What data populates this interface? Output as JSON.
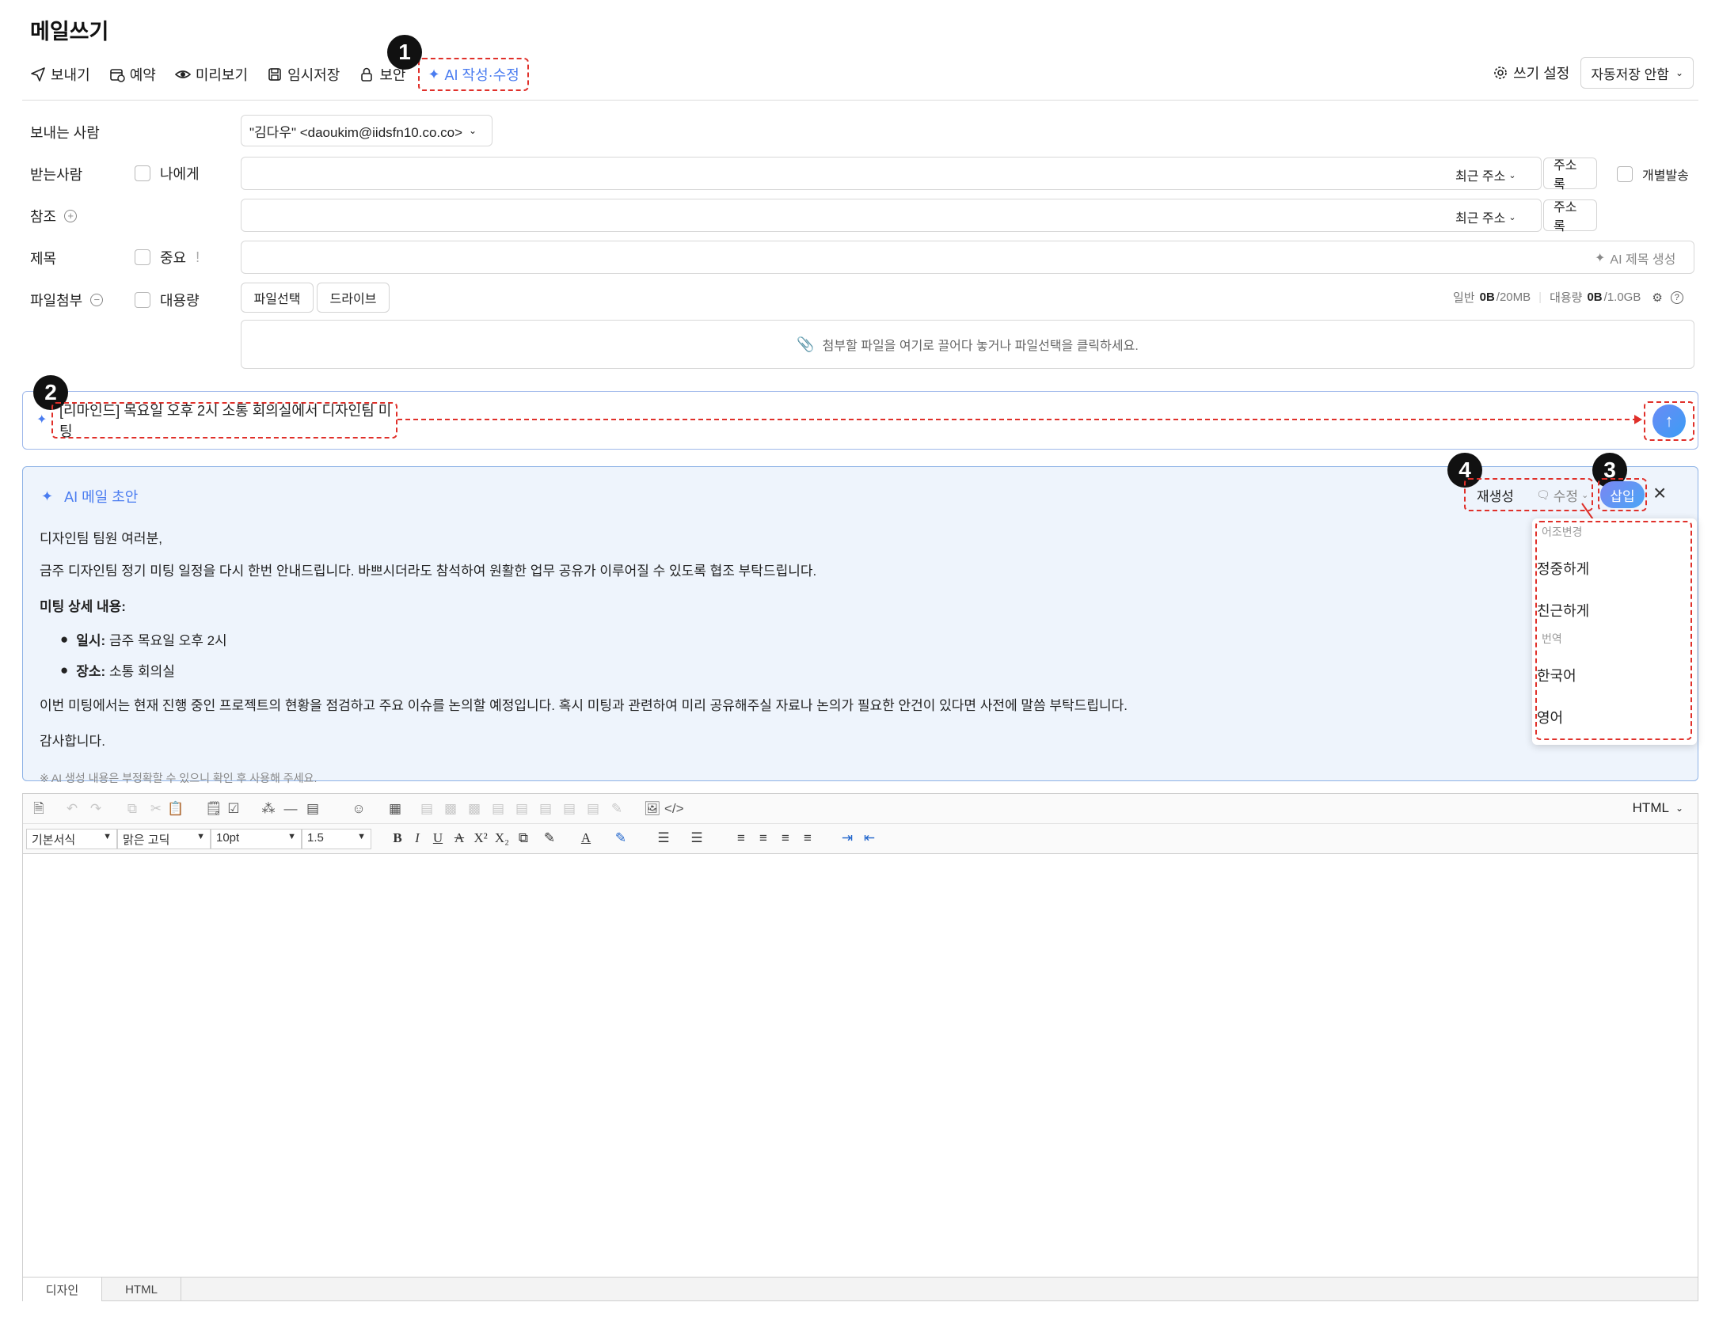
{
  "page_title": "메일쓰기",
  "toolbar": {
    "send": "보내기",
    "reserve": "예약",
    "preview": "미리보기",
    "draft_save": "임시저장",
    "security": "보안",
    "ai_compose": "AI 작성·수정",
    "write_settings": "쓰기 설정",
    "autosave": "자동저장 안함"
  },
  "markers": [
    "1",
    "2",
    "3",
    "4"
  ],
  "form": {
    "sender_label": "보내는 사람",
    "sender_value": "\"김다우\" <daoukim@iidsfn10.co.co>",
    "to_label": "받는사람",
    "to_self": "나에게",
    "recent_address": "최근 주소",
    "address_book": "주소록",
    "individual_send": "개별발송",
    "cc_label": "참조",
    "subject_label": "제목",
    "important": "중요",
    "important_mark": "!",
    "ai_subject": "AI 제목 생성",
    "attach_label": "파일첨부",
    "large_file": "대용량",
    "file_select": "파일선택",
    "drive": "드라이브",
    "quota_normal_label": "일반",
    "quota_normal_used": "0B",
    "quota_normal_total": "/20MB",
    "quota_large_label": "대용량",
    "quota_large_used": "0B",
    "quota_large_total": "/1.0GB",
    "drop_hint": "첨부할 파일을 여기로 끌어다 놓거나 파일선택을 클릭하세요."
  },
  "prompt": {
    "text": "[리마인드] 목요일 오후 2시 소통 회의실에서 디자인팀 미팅"
  },
  "ai_draft": {
    "header": "AI 메일 초안",
    "regenerate": "재생성",
    "edit": "수정",
    "insert": "삽입",
    "greeting": "디자인팀 팀원 여러분,",
    "intro": "금주 디자인팀 정기 미팅 일정을 다시 한번 안내드립니다. 바쁘시더라도 참석하여 원활한 업무 공유가 이루어질 수 있도록 협조 부탁드립니다.",
    "detail_heading": "미팅 상세 내용:",
    "bullets": [
      {
        "key": "일시:",
        "value": " 금주 목요일 오후 2시"
      },
      {
        "key": "장소:",
        "value": " 소통 회의실"
      }
    ],
    "body": "이번 미팅에서는 현재 진행 중인 프로젝트의 현황을 점검하고 주요 이슈를 논의할 예정입니다. 혹시 미팅과 관련하여 미리 공유해주실 자료나 논의가 필요한 안건이 있다면 사전에 말씀 부탁드립니다.",
    "closing": "감사합니다.",
    "disclaimer": "※ AI 생성 내용은 부정확할 수 있으니 확인 후 사용해 주세요."
  },
  "edit_menu": {
    "tone_header": "어조변경",
    "tone_items": [
      "정중하게",
      "친근하게"
    ],
    "translate_header": "번역",
    "translate_items": [
      "한국어",
      "영어"
    ]
  },
  "editor": {
    "mode": "HTML",
    "style_select": "기본서식",
    "font_select": "맑은 고딕",
    "size_select": "10pt",
    "line_height_select": "1.5",
    "tabs": [
      "디자인",
      "HTML"
    ]
  }
}
